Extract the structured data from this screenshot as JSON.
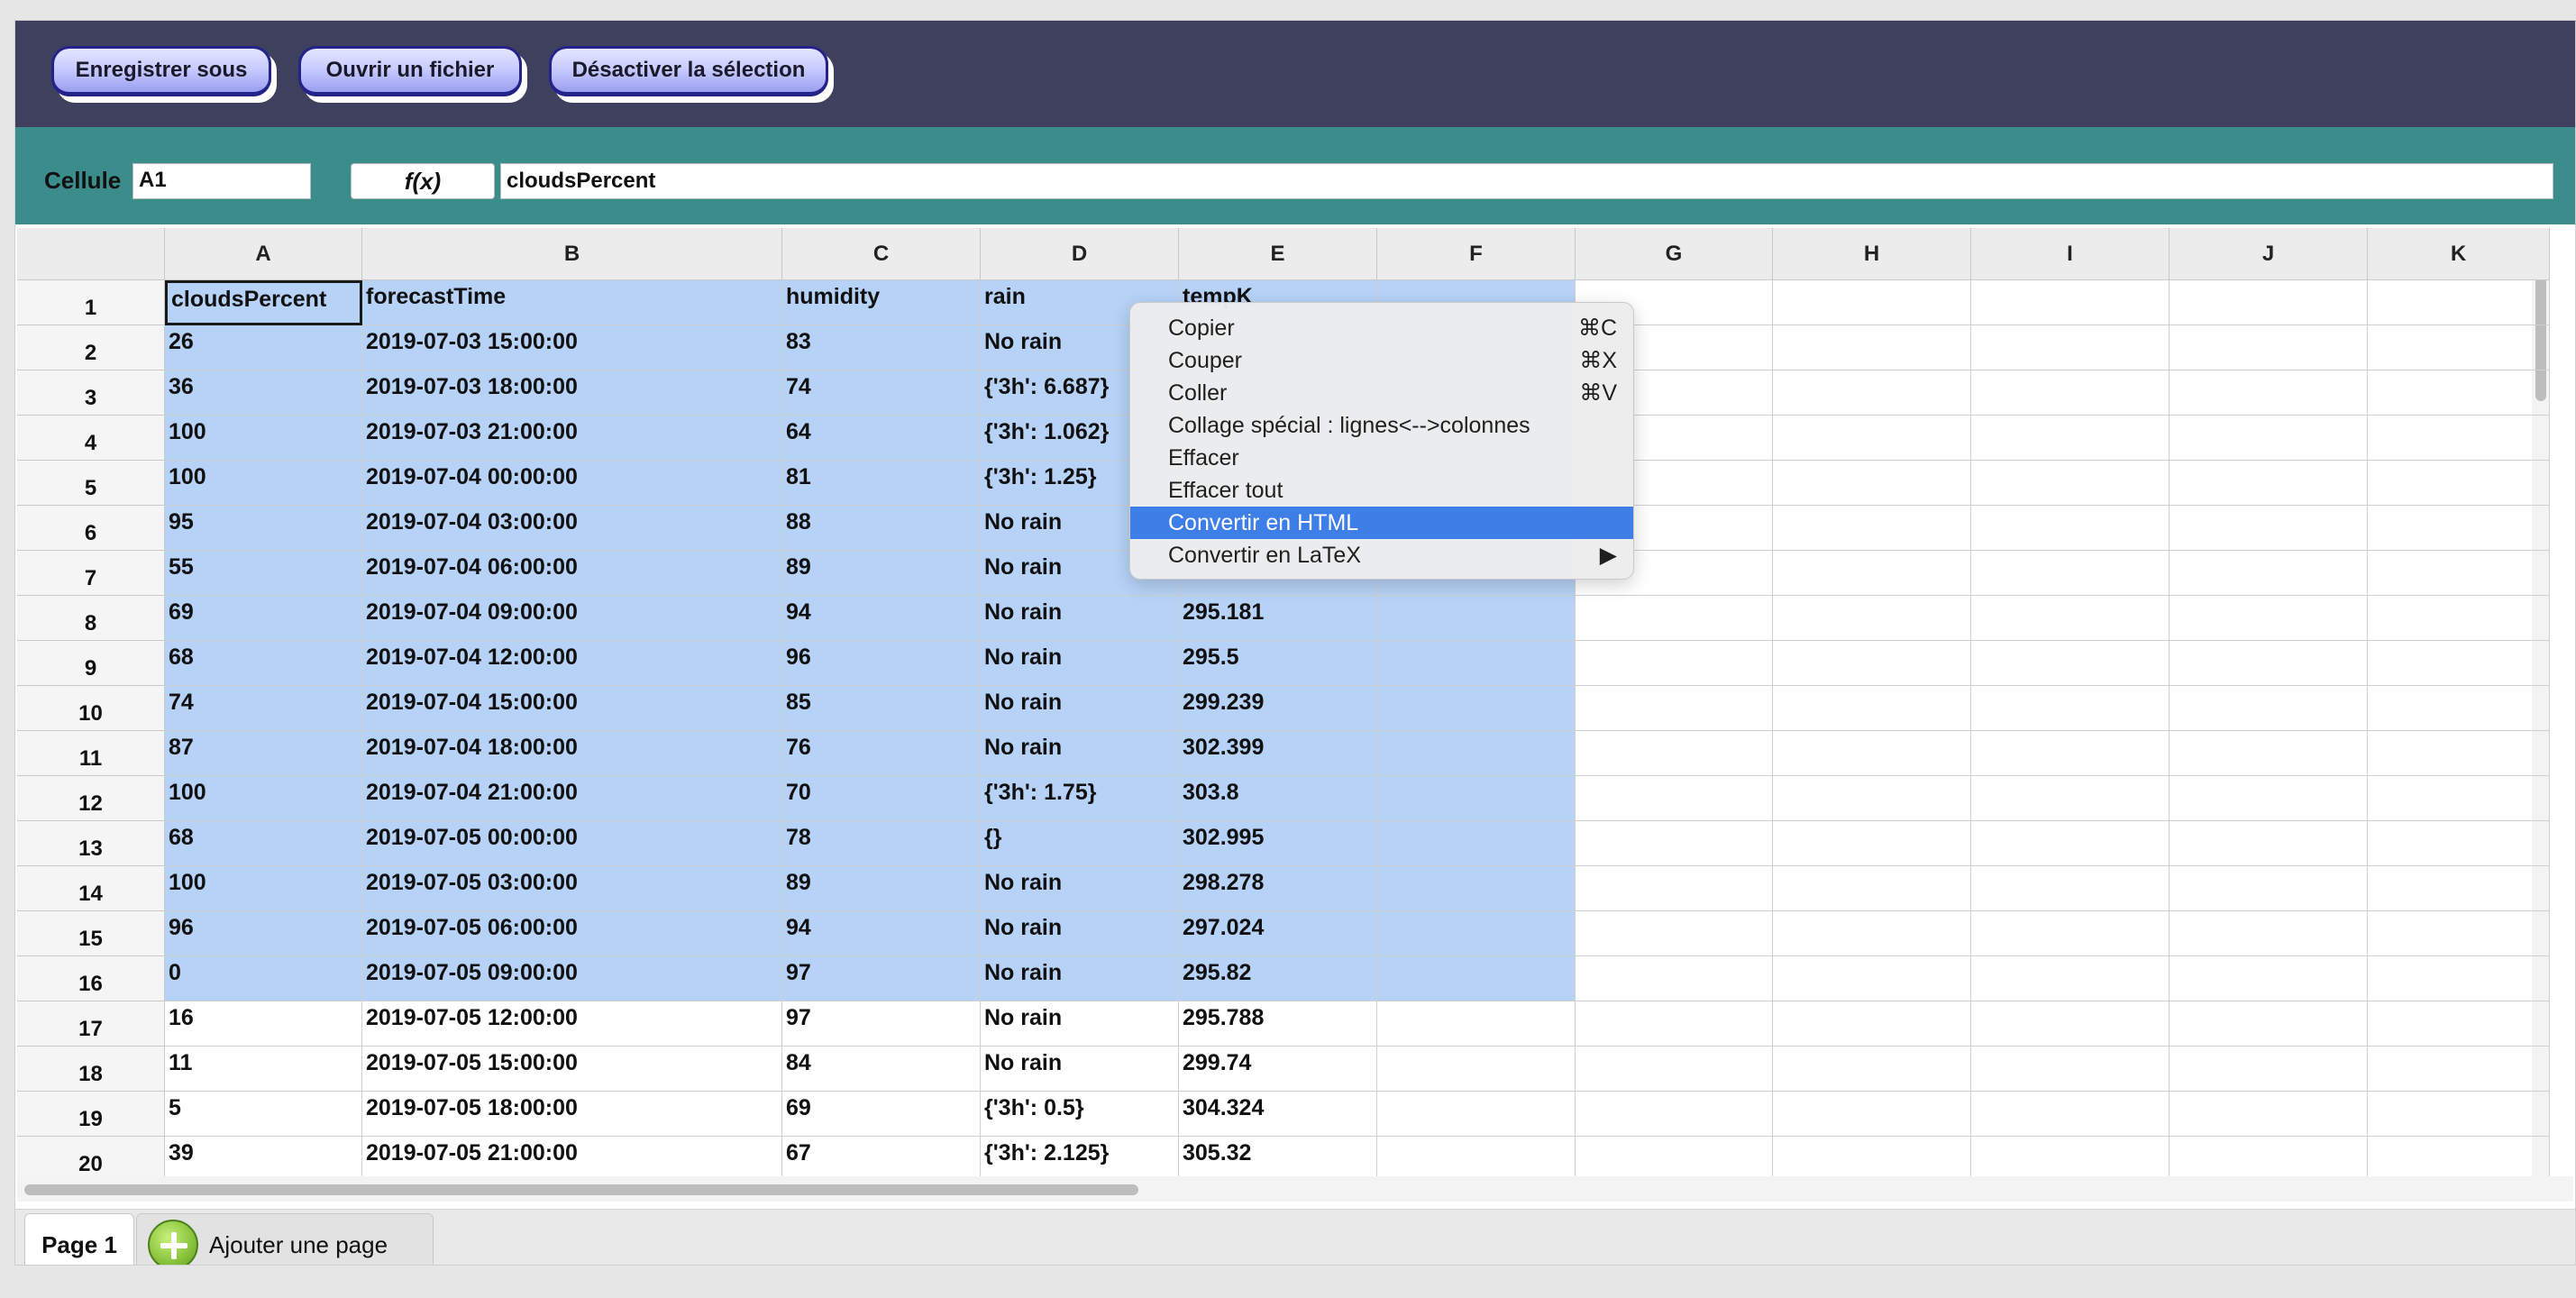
{
  "toolbar": {
    "save_as": "Enregistrer sous",
    "open_file": "Ouvrir un fichier",
    "deselect": "Désactiver la sélection"
  },
  "formula_bar": {
    "cell_label": "Cellule",
    "cell_ref": "A1",
    "fx_label": "f(x)",
    "formula": "cloudsPercent"
  },
  "columns": [
    "A",
    "B",
    "C",
    "D",
    "E",
    "F",
    "G",
    "H",
    "I",
    "J",
    "K"
  ],
  "rows": [
    {
      "n": "1",
      "A": "cloudsPercent",
      "B": "forecastTime",
      "C": "humidity",
      "D": "rain",
      "E": "tempK"
    },
    {
      "n": "2",
      "A": "26",
      "B": "2019-07-03 15:00:00",
      "C": "83",
      "D": "No rain",
      "E": ""
    },
    {
      "n": "3",
      "A": "36",
      "B": "2019-07-03 18:00:00",
      "C": "74",
      "D": "{'3h': 6.687}",
      "E": ""
    },
    {
      "n": "4",
      "A": "100",
      "B": "2019-07-03 21:00:00",
      "C": "64",
      "D": "{'3h': 1.062}",
      "E": ""
    },
    {
      "n": "5",
      "A": "100",
      "B": "2019-07-04 00:00:00",
      "C": "81",
      "D": "{'3h': 1.25}",
      "E": ""
    },
    {
      "n": "6",
      "A": "95",
      "B": "2019-07-04 03:00:00",
      "C": "88",
      "D": "No rain",
      "E": ""
    },
    {
      "n": "7",
      "A": "55",
      "B": "2019-07-04 06:00:00",
      "C": "89",
      "D": "No rain",
      "E": ""
    },
    {
      "n": "8",
      "A": "69",
      "B": "2019-07-04 09:00:00",
      "C": "94",
      "D": "No rain",
      "E": "295.181"
    },
    {
      "n": "9",
      "A": "68",
      "B": "2019-07-04 12:00:00",
      "C": "96",
      "D": "No rain",
      "E": "295.5"
    },
    {
      "n": "10",
      "A": "74",
      "B": "2019-07-04 15:00:00",
      "C": "85",
      "D": "No rain",
      "E": "299.239"
    },
    {
      "n": "11",
      "A": "87",
      "B": "2019-07-04 18:00:00",
      "C": "76",
      "D": "No rain",
      "E": "302.399"
    },
    {
      "n": "12",
      "A": "100",
      "B": "2019-07-04 21:00:00",
      "C": "70",
      "D": "{'3h': 1.75}",
      "E": "303.8"
    },
    {
      "n": "13",
      "A": "68",
      "B": "2019-07-05 00:00:00",
      "C": "78",
      "D": "{}",
      "E": "302.995"
    },
    {
      "n": "14",
      "A": "100",
      "B": "2019-07-05 03:00:00",
      "C": "89",
      "D": "No rain",
      "E": "298.278"
    },
    {
      "n": "15",
      "A": "96",
      "B": "2019-07-05 06:00:00",
      "C": "94",
      "D": "No rain",
      "E": "297.024"
    },
    {
      "n": "16",
      "A": "0",
      "B": "2019-07-05 09:00:00",
      "C": "97",
      "D": "No rain",
      "E": "295.82"
    },
    {
      "n": "17",
      "A": "16",
      "B": "2019-07-05 12:00:00",
      "C": "97",
      "D": "No rain",
      "E": "295.788"
    },
    {
      "n": "18",
      "A": "11",
      "B": "2019-07-05 15:00:00",
      "C": "84",
      "D": "No rain",
      "E": "299.74"
    },
    {
      "n": "19",
      "A": "5",
      "B": "2019-07-05 18:00:00",
      "C": "69",
      "D": "{'3h': 0.5}",
      "E": "304.324"
    },
    {
      "n": "20",
      "A": "39",
      "B": "2019-07-05 21:00:00",
      "C": "67",
      "D": "{'3h': 2.125}",
      "E": "305.32"
    }
  ],
  "context_menu": {
    "items": [
      {
        "label": "Copier",
        "shortcut": "⌘C"
      },
      {
        "label": "Couper",
        "shortcut": "⌘X"
      },
      {
        "label": "Coller",
        "shortcut": "⌘V"
      },
      {
        "label": "Collage spécial : lignes<-->colonnes",
        "shortcut": ""
      },
      {
        "label": "Effacer",
        "shortcut": ""
      },
      {
        "label": "Effacer tout",
        "shortcut": ""
      },
      {
        "label": "Convertir en HTML",
        "shortcut": ""
      },
      {
        "label": "Convertir en LaTeX",
        "shortcut": "▶"
      }
    ],
    "highlighted_index": 6
  },
  "tabs": {
    "page1": "Page 1",
    "add_page": "Ajouter une page"
  },
  "colors": {
    "topbar": "#3f3f5e",
    "formula_bar": "#3b8d8b",
    "selection": "#b6d2f7",
    "menu_highlight": "#3d7fe6"
  }
}
